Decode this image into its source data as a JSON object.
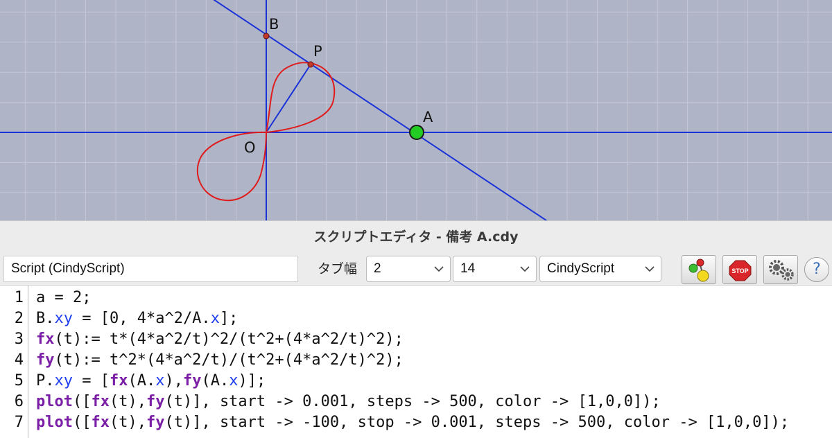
{
  "canvas": {
    "labels": {
      "O": "O",
      "A": "A",
      "B": "B",
      "P": "P"
    },
    "colors": {
      "background": "#afb4c6",
      "grid": "#c4c8d6",
      "axis": "#1a32d8",
      "curve": "#e01b1b",
      "point_A": "#22cc22",
      "point": "#c43a2a"
    }
  },
  "window": {
    "title": "スクリプトエディタ - 備考 A.cdy"
  },
  "toolbar": {
    "script_name": "Script (CindyScript)",
    "tab_width_label": "タブ幅",
    "tab_width_value": "2",
    "font_size_value": "14",
    "language_value": "CindyScript",
    "run_icon": "run-script-icon",
    "stop_label": "STOP",
    "settings_icon": "gears-icon",
    "help_label": "?"
  },
  "code": {
    "line_numbers": [
      "1",
      "2",
      "3",
      "4",
      "5",
      "6",
      "7"
    ],
    "lines": [
      [
        {
          "t": "a = 2;",
          "c": "plain"
        }
      ],
      [
        {
          "t": "B.",
          "c": "plain"
        },
        {
          "t": "xy",
          "c": "prop"
        },
        {
          "t": " = [0, 4*a^2/A.",
          "c": "plain"
        },
        {
          "t": "x",
          "c": "prop"
        },
        {
          "t": "];",
          "c": "plain"
        }
      ],
      [
        {
          "t": "fx",
          "c": "fn"
        },
        {
          "t": "(t):= t*(4*a^2/t)^2/(t^2+(4*a^2/t)^2);",
          "c": "plain"
        }
      ],
      [
        {
          "t": "fy",
          "c": "fn"
        },
        {
          "t": "(t):= t^2*(4*a^2/t)/(t^2+(4*a^2/t)^2);",
          "c": "plain"
        }
      ],
      [
        {
          "t": "P.",
          "c": "plain"
        },
        {
          "t": "xy",
          "c": "prop"
        },
        {
          "t": " = [",
          "c": "plain"
        },
        {
          "t": "fx",
          "c": "fn"
        },
        {
          "t": "(A.",
          "c": "plain"
        },
        {
          "t": "x",
          "c": "prop"
        },
        {
          "t": "),",
          "c": "plain"
        },
        {
          "t": "fy",
          "c": "fn"
        },
        {
          "t": "(A.",
          "c": "plain"
        },
        {
          "t": "x",
          "c": "prop"
        },
        {
          "t": ")];",
          "c": "plain"
        }
      ],
      [
        {
          "t": "plot",
          "c": "fn"
        },
        {
          "t": "([",
          "c": "plain"
        },
        {
          "t": "fx",
          "c": "fn"
        },
        {
          "t": "(t),",
          "c": "plain"
        },
        {
          "t": "fy",
          "c": "fn"
        },
        {
          "t": "(t)], start -> 0.001, steps -> 500, color -> [1,0,0]);",
          "c": "plain"
        }
      ],
      [
        {
          "t": "plot",
          "c": "fn"
        },
        {
          "t": "([",
          "c": "plain"
        },
        {
          "t": "fx",
          "c": "fn"
        },
        {
          "t": "(t),",
          "c": "plain"
        },
        {
          "t": "fy",
          "c": "fn"
        },
        {
          "t": "(t)], start -> -100, stop -> 0.001, steps -> 500, color -> [1,0,0]);",
          "c": "plain"
        }
      ]
    ]
  }
}
